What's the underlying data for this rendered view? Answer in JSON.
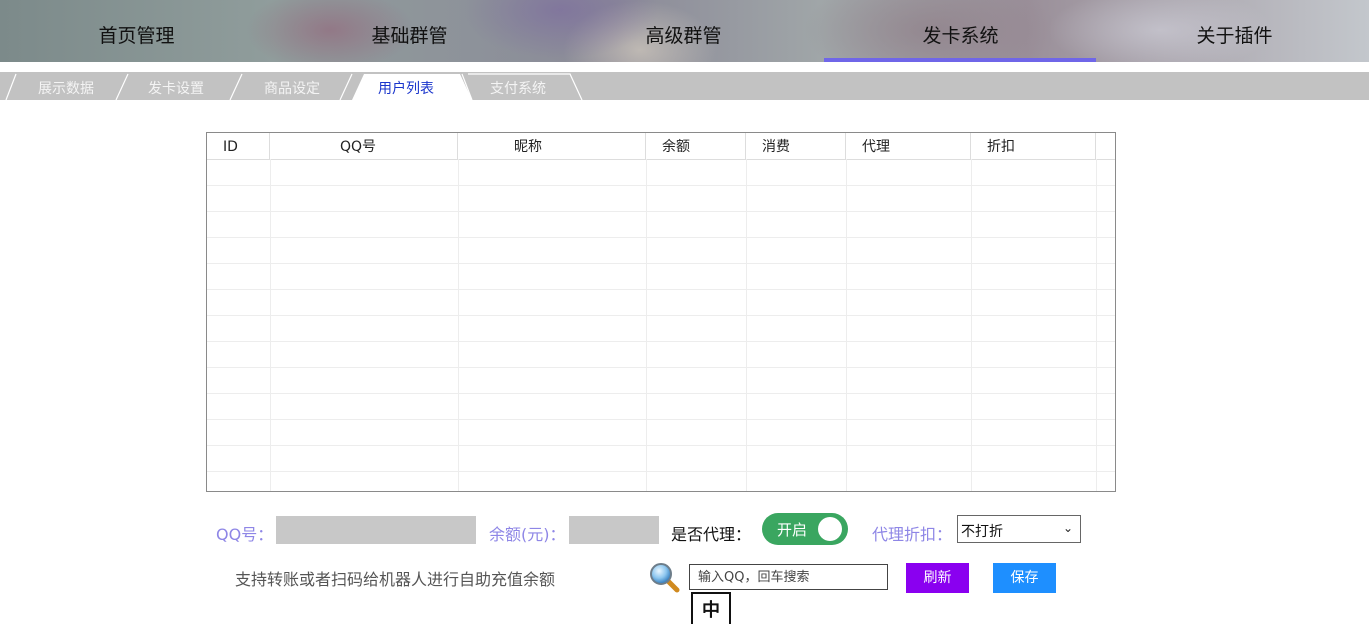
{
  "nav": {
    "items": [
      {
        "label": "首页管理"
      },
      {
        "label": "基础群管"
      },
      {
        "label": "高级群管"
      },
      {
        "label": "发卡系统"
      },
      {
        "label": "关于插件"
      }
    ],
    "active_index": 3
  },
  "tabs": {
    "items": [
      {
        "label": "展示数据"
      },
      {
        "label": "发卡设置"
      },
      {
        "label": "商品设定"
      },
      {
        "label": "用户列表"
      },
      {
        "label": "支付系统"
      }
    ],
    "active_index": 3
  },
  "table": {
    "columns": [
      "ID",
      "QQ号",
      "昵称",
      "余额",
      "消费",
      "代理",
      "折扣"
    ],
    "rows": []
  },
  "form": {
    "qq_label": "QQ号：",
    "balance_label": "余额(元)：",
    "agent_label": "是否代理：",
    "agent_toggle_label": "开启",
    "discount_label": "代理折扣：",
    "discount_value": "不打折",
    "info_text": "支持转账或者扫码给机器人进行自助充值余额",
    "search_placeholder": "输入QQ，回车搜索",
    "refresh_label": "刷新",
    "save_label": "保存",
    "ime_indicator": "中"
  },
  "colors": {
    "accent": "#6f66e8",
    "label": "#8e86e6",
    "toggle_on": "#3aa660",
    "refresh_button": "#8a00f0",
    "save_button": "#1e8fff"
  }
}
